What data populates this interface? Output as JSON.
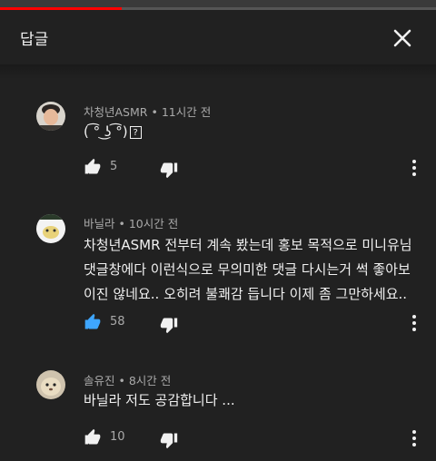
{
  "header": {
    "title": "답글"
  },
  "progress": {
    "fraction": 0.28
  },
  "comments": [
    {
      "author": "차청년ASMR",
      "time": "11시간 전",
      "text": "( ͡° ͜ʖ ͡°)",
      "text_suffix": "?",
      "likes": "5",
      "liked": false
    },
    {
      "author": "바닐라",
      "time": "10시간 전",
      "text": "차청년ASMR 전부터 계속 봤는데 홍보 목적으로 미니유님 댓글창에다 이런식으로 무의미한 댓글 다시는거 썩 좋아보이진 않네요.. 오히려 불쾌감 듭니다 이제 좀 그만하세요..",
      "likes": "58",
      "liked": true
    },
    {
      "author": "솔유진",
      "time": "8시간 전",
      "text": "바닐라 저도 공감합니다 ...",
      "likes": "10",
      "liked": false
    }
  ],
  "colors": {
    "accent_like": "#3ea6ff",
    "progress": "#ff0000",
    "background": "#212121"
  },
  "icons": {
    "close": "close-icon",
    "like": "thumb-up-icon",
    "dislike": "thumb-down-icon",
    "more": "more-vert-icon"
  }
}
